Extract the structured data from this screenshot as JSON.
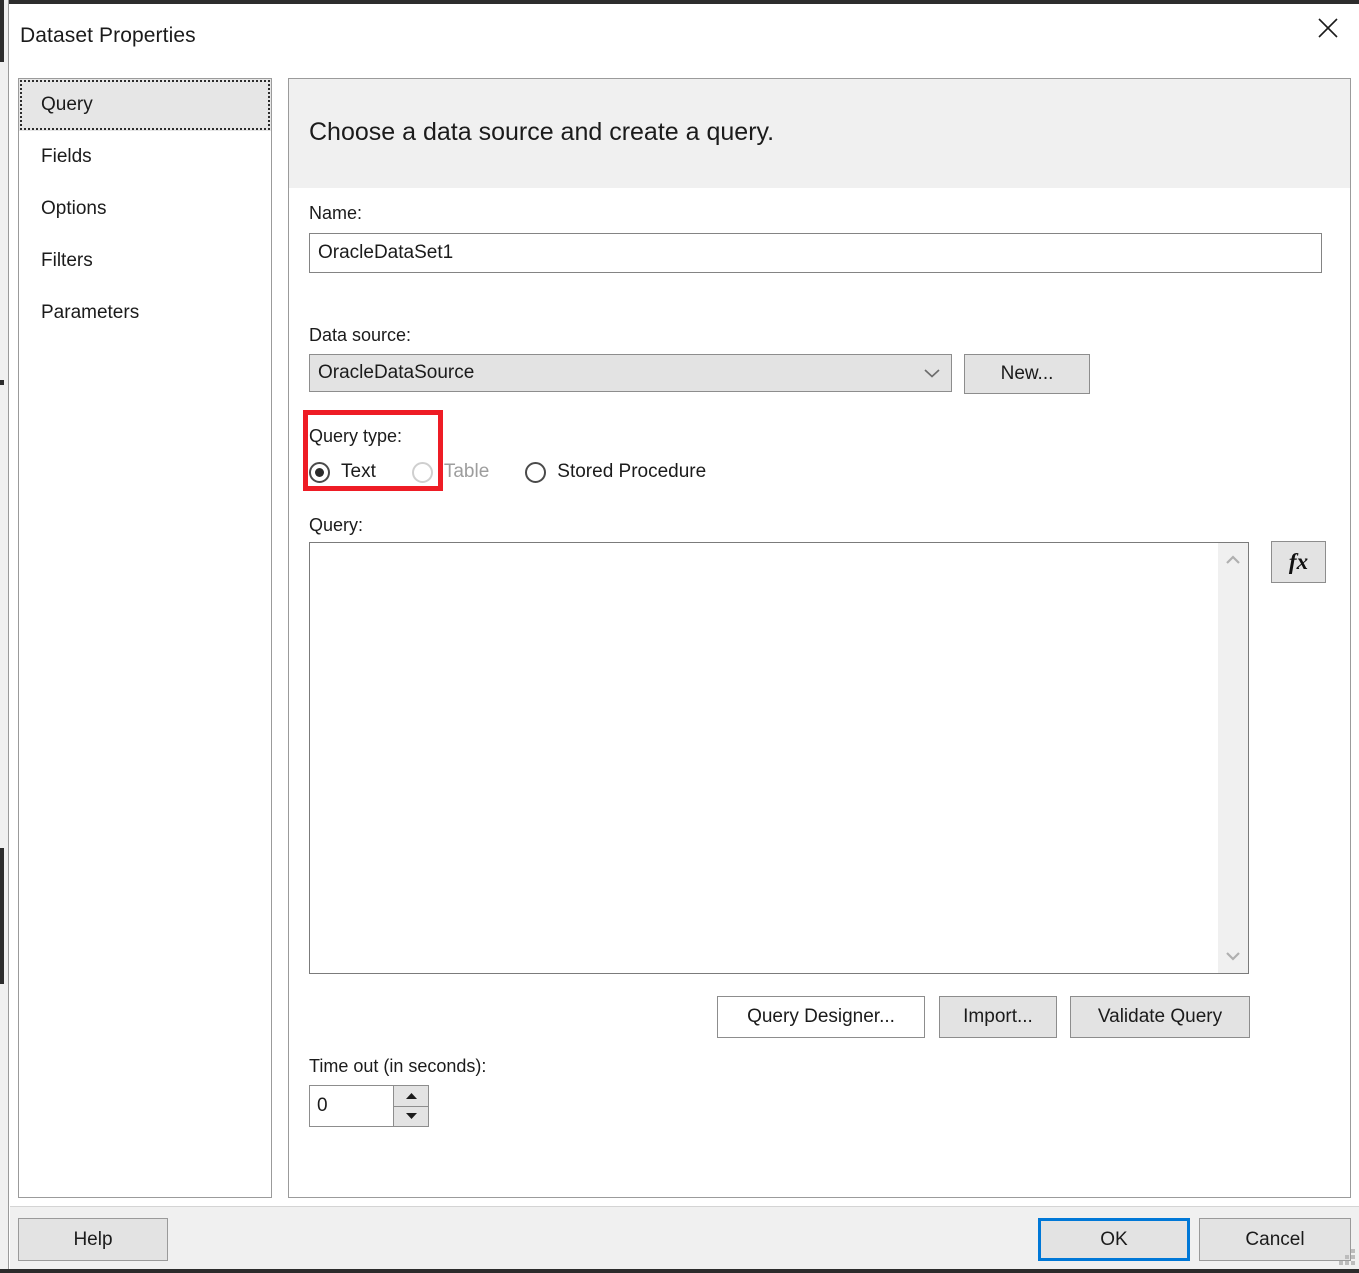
{
  "dialog": {
    "title": "Dataset Properties",
    "close_icon": "close-icon"
  },
  "sidebar": {
    "items": [
      {
        "label": "Query",
        "selected": true
      },
      {
        "label": "Fields",
        "selected": false
      },
      {
        "label": "Options",
        "selected": false
      },
      {
        "label": "Filters",
        "selected": false
      },
      {
        "label": "Parameters",
        "selected": false
      }
    ]
  },
  "panel": {
    "heading": "Choose a data source and create a query.",
    "name": {
      "label": "Name:",
      "value": "OracleDataSet1",
      "placeholder": ""
    },
    "data_source": {
      "label": "Data source:",
      "value": "OracleDataSource",
      "arrow_icon": "chevron-down-icon",
      "new_button": "New..."
    },
    "query_type": {
      "label": "Query type:",
      "highlight_color": "#ee1c25",
      "options": [
        {
          "label": "Text",
          "checked": true,
          "disabled": false
        },
        {
          "label": "Table",
          "checked": false,
          "disabled": true
        },
        {
          "label": "Stored Procedure",
          "checked": false,
          "disabled": false
        }
      ]
    },
    "query": {
      "label": "Query:",
      "value": "",
      "placeholder": "",
      "scroll_up_icon": "chevron-up-icon",
      "scroll_down_icon": "chevron-down-icon",
      "expression_button": "fx"
    },
    "actions": {
      "query_designer": "Query Designer...",
      "import": "Import...",
      "validate": "Validate Query"
    },
    "timeout": {
      "label": "Time out (in seconds):",
      "value": "0",
      "increment_icon": "triangle-up-icon",
      "decrement_icon": "triangle-down-icon"
    }
  },
  "footer": {
    "help": "Help",
    "ok": "OK",
    "cancel": "Cancel",
    "ok_focus_color": "#0078d7"
  }
}
